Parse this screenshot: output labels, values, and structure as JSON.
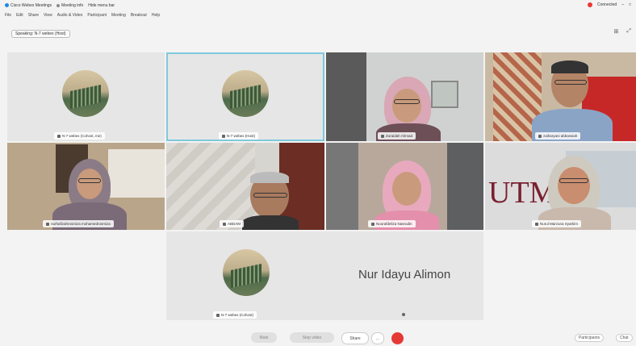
{
  "titlebar": {
    "app_name": "Cisco Webex Meetings",
    "meeting_info": "Meeting info",
    "hide_menu": "Hide menu bar",
    "status": "Connected"
  },
  "menu": [
    "File",
    "Edit",
    "Share",
    "View",
    "Audio & Video",
    "Participant",
    "Meeting",
    "Breakout",
    "Help"
  ],
  "speaking": "Speaking: N-7 webex (Host)",
  "tiles": [
    {
      "name": "N-7 webex (Cohost, me)",
      "kind": "avatar"
    },
    {
      "name": "N-7 webex (Host)",
      "kind": "avatar"
    },
    {
      "name": "Zuraidah Ahmad",
      "kind": "video"
    },
    {
      "name": "zaiharyani abbassiah",
      "kind": "video"
    },
    {
      "name": "nurhafizahrosmiza mohamedrosmiza",
      "kind": "video"
    },
    {
      "name": "ABDAM",
      "kind": "video"
    },
    {
      "name": "Noorafdeliza Nasrudin",
      "kind": "video"
    },
    {
      "name": "Nurul Marzuna Syarkim",
      "kind": "video"
    }
  ],
  "featured": {
    "display_name": "Nur Idayu Alimon",
    "label": "N-7 webex (Cohost)"
  },
  "toolbar": {
    "mute": "Mute",
    "stop_video": "Stop video",
    "share": "Share",
    "more": "...",
    "participants": "Participants",
    "chat": "Chat"
  },
  "colors": {
    "accent": "#7fc8dc",
    "end": "#e53935",
    "record": "#e53935"
  }
}
